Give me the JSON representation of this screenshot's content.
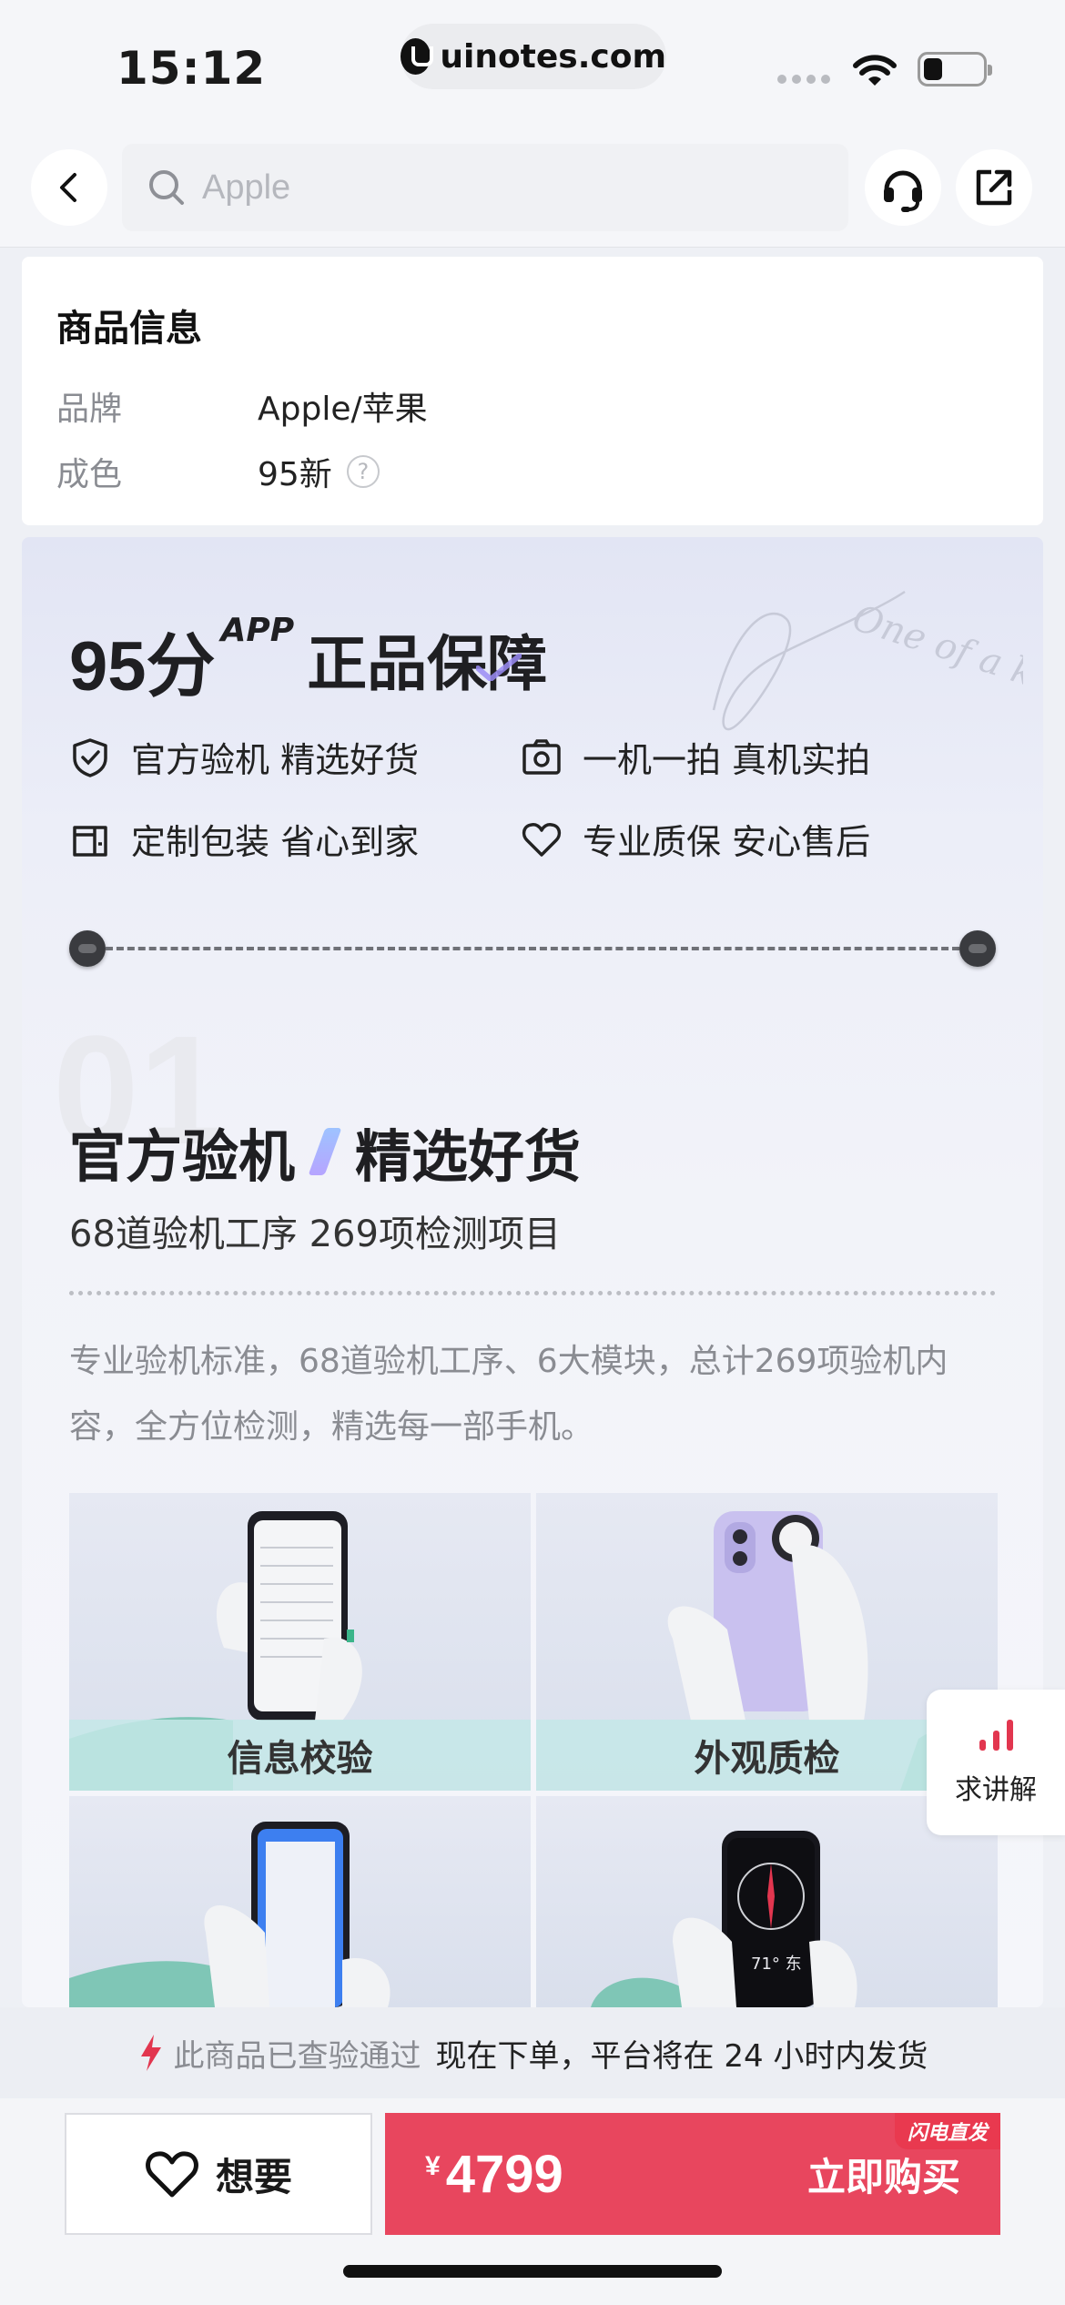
{
  "status_bar": {
    "time": "15:12",
    "url": "uinotes.com"
  },
  "nav": {
    "search_placeholder": "Apple"
  },
  "product_info": {
    "title": "商品信息",
    "rows": [
      {
        "label": "品牌",
        "value": "Apple/苹果"
      },
      {
        "label": "成色",
        "value": "95新"
      }
    ]
  },
  "guarantee": {
    "title_score": "95分",
    "title_app": "APP",
    "title_main": "正品保障",
    "script_text": "One of a kind",
    "features": [
      {
        "icon": "shield-check-icon",
        "text": "官方验机 精选好货"
      },
      {
        "icon": "camera-icon",
        "text": "一机一拍 真机实拍"
      },
      {
        "icon": "package-icon",
        "text": "定制包装 省心到家"
      },
      {
        "icon": "heart-icon",
        "text": "专业质保 安心售后"
      }
    ],
    "section_number": "01",
    "section_title_left": "官方验机",
    "section_title_right": "精选好货",
    "section_subtitle": "68道验机工序 269项检测项目",
    "section_desc": "专业验机标准，68道验机工序、6大模块，总计269项验机内容，全方位检测，精选每一部手机。",
    "tiles": [
      {
        "label": "信息校验"
      },
      {
        "label": "外观质检"
      },
      {
        "label": ""
      },
      {
        "label": ""
      }
    ]
  },
  "floating": {
    "label": "求讲解"
  },
  "notice": {
    "verified": "此商品已查验通过",
    "shipping": "现在下单，平台将在 24 小时内发货"
  },
  "actions": {
    "want_label": "想要",
    "currency": "¥",
    "price": "4799",
    "buy_label": "立即购买",
    "flash_tag": "闪电直发"
  },
  "colors": {
    "accent": "#e8465e",
    "bolt": "#e2364f"
  }
}
